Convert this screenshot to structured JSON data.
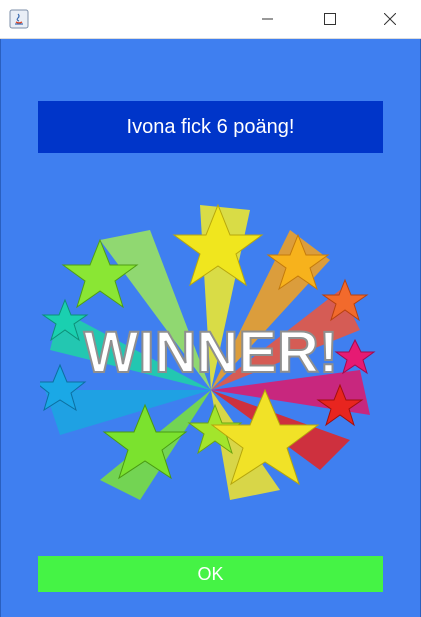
{
  "window": {
    "app_icon": "java-icon",
    "controls": [
      "minimize-icon",
      "maximize-icon",
      "close-icon"
    ]
  },
  "banner": {
    "text": "Ivona fick 6 poäng!"
  },
  "image": {
    "text": "WINNER!",
    "icon": "winner-stars-illustration"
  },
  "ok_button": {
    "label": "OK"
  },
  "colors": {
    "background": "#3f7ff0",
    "banner_bg": "#0035c9",
    "ok_bg": "#45f345",
    "text": "#ffffff"
  }
}
